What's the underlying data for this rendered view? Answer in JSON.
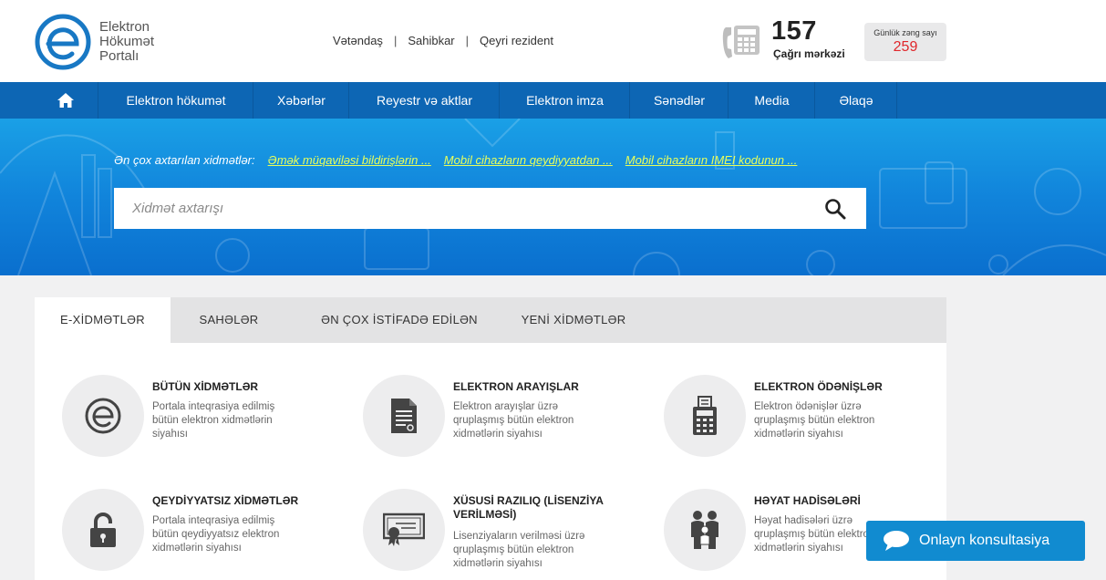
{
  "logo": {
    "line1": "Elektron",
    "line2": "Hökumət",
    "line3": "Portalı",
    "color": "#1878c4"
  },
  "userlinks": {
    "citizen": "Vətəndaş",
    "business": "Sahibkar",
    "nonresident": "Qeyri rezident",
    "separator": "|"
  },
  "hotline": {
    "number": "157",
    "label": "Çağrı mərkəzi",
    "counter_label": "Günlük zəng sayı",
    "counter_value": "259"
  },
  "nav": {
    "home_icon": "home-icon",
    "items": [
      "Elektron hökumət",
      "Xəbərlər",
      "Reyestr və aktlar",
      "Elektron imza",
      "Sənədlər",
      "Media",
      "Əlaqə"
    ]
  },
  "hero": {
    "popular_label": "Ən çox axtarılan xidmətlər:",
    "popular_links": [
      "Əmək müqaviləsi bildirişlərin ...",
      "Mobil cihazların qeydiyyatdan ...",
      "Mobil cihazların IMEI kodunun ..."
    ],
    "search_placeholder": "Xidmət axtarışı"
  },
  "tabs": [
    "E-XİDMƏTLƏR",
    "SAHƏLƏR",
    "ƏN ÇOX İSTİFADƏ EDİLƏN",
    "YENİ XİDMƏTLƏR"
  ],
  "services": [
    {
      "title": "BÜTÜN XİDMƏTLƏR",
      "desc": "Portala inteqrasiya edilmiş bütün elektron xidmətlərin siyahısı",
      "icon": "e-logo-icon"
    },
    {
      "title": "ELEKTRON ARAYIŞLAR",
      "desc": "Elektron arayışlar üzrə qruplaşmış bütün elektron xidmətlərin siyahısı",
      "icon": "document-icon"
    },
    {
      "title": "ELEKTRON ÖDƏNİŞLƏR",
      "desc": "Elektron ödənişlər üzrə qruplaşmış bütün elektron xidmətlərin siyahısı",
      "icon": "calculator-icon"
    },
    {
      "title": "QEYDİYYATSIZ XİDMƏTLƏR",
      "desc": "Portala inteqrasiya edilmiş bütün qeydiyyatsız elektron xidmətlərin siyahısı",
      "icon": "unlock-icon"
    },
    {
      "title": "XÜSUSİ RAZILIQ (LİSENZİYA VERİLMƏSİ)",
      "desc": "Lisenziyaların verilməsi üzrə qruplaşmış bütün elektron xidmətlərin siyahısı",
      "icon": "certificate-icon"
    },
    {
      "title": "HƏYAT HADİSƏLƏRİ",
      "desc": "Həyat hadisələri üzrə qruplaşmış bütün elektron xidmətlərin siyahısı",
      "icon": "family-icon"
    }
  ],
  "chat": {
    "label": "Onlayn konsultasiya",
    "icon": "chat-bubble-icon"
  },
  "colors": {
    "nav": "#0d66b4",
    "accent_link": "#e9ff5a",
    "counter_value": "#e0272b",
    "chat": "#118bd0"
  }
}
